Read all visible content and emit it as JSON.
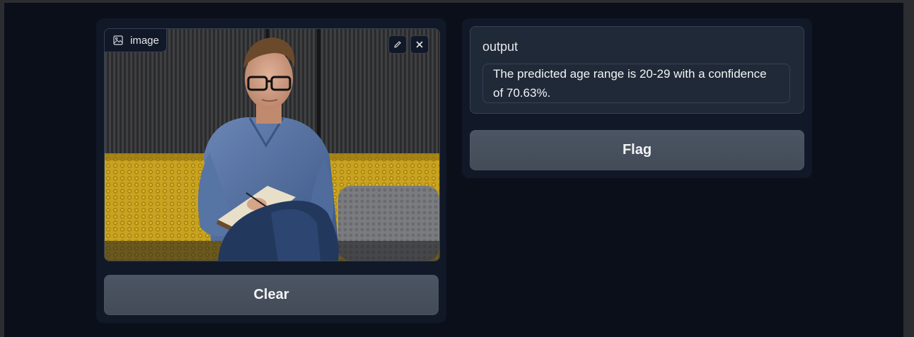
{
  "input": {
    "label": "image",
    "image_alt": "Young man with glasses in a blue denim shirt writing in a notebook on a yellow sofa",
    "tools": {
      "edit_icon": "pencil-icon",
      "close_icon": "close-icon"
    }
  },
  "buttons": {
    "clear_label": "Clear",
    "flag_label": "Flag"
  },
  "output": {
    "label": "output",
    "text": "The predicted age range is 20-29 with a confidence of 70.63%."
  },
  "colors": {
    "background": "#0b0f19",
    "panel": "#111827",
    "button": "#4b5563",
    "text": "#f3f4f6"
  }
}
